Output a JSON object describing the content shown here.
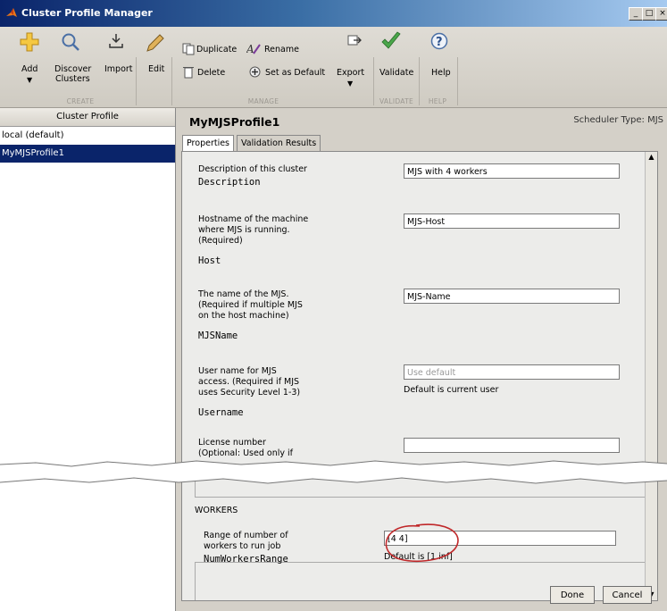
{
  "window": {
    "title": "Cluster Profile Manager",
    "buttons": [
      "_",
      "□",
      "×"
    ]
  },
  "toolstrip": {
    "add": "Add",
    "discover_line1": "Discover",
    "discover_line2": "Clusters",
    "import": "Import",
    "edit": "Edit",
    "duplicate": "Duplicate",
    "rename": "Rename",
    "delete": "Delete",
    "set_default": "Set as Default",
    "export": "Export",
    "validate": "Validate",
    "help": "Help",
    "groups": {
      "create": "CREATE",
      "manage": "MANAGE",
      "validate": "VALIDATE",
      "help": "HELP"
    }
  },
  "left_panel": {
    "header": "Cluster Profile",
    "profiles": [
      "local (default)",
      "MyMJSProfile1"
    ],
    "selected_index": 1
  },
  "right_panel": {
    "profile_name": "MyMJSProfile1",
    "scheduler_type": "Scheduler Type: MJS",
    "tabs": [
      "Properties",
      "Validation Results"
    ],
    "active_tab": 0
  },
  "properties": {
    "description": {
      "label": "Description of this cluster",
      "name": "Description",
      "value": "MJS with 4 workers"
    },
    "host": {
      "label": "Hostname of the machine where MJS is running. (Required)",
      "name": "Host",
      "value": "MJS-Host"
    },
    "mjsname": {
      "label": "The name of the MJS. (Required if multiple MJS on the host machine)",
      "name": "MJSName",
      "value": "MJS-Name"
    },
    "username": {
      "label": "User name for MJS access. (Required if MJS uses Security Level 1-3)",
      "name": "Username",
      "placeholder": "Use default",
      "hint": "Default is current user"
    },
    "license": {
      "label": "License number (Optional: Used only if",
      "value": ""
    }
  },
  "workers": {
    "section_title": "WORKERS",
    "label": "Range of number of workers to run job",
    "name": "NumWorkersRange",
    "value": "[4 4]",
    "hint": "Default is [1 inf]"
  },
  "footer": {
    "done": "Done",
    "cancel": "Cancel"
  },
  "colors": {
    "title_bar": "#0a246a",
    "selection": "#0a246a",
    "annotation_circle": "#c0282a"
  }
}
